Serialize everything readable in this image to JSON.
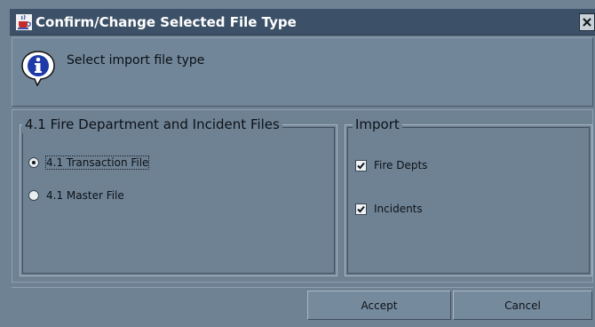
{
  "window": {
    "title": "Confirm/Change Selected File Type",
    "close_symbol": "×",
    "app_icon": "java-cup-icon"
  },
  "info": {
    "icon": "info-icon",
    "message": "Select import file type"
  },
  "fire_group": {
    "legend": "4.1 Fire Department and Incident Files",
    "options": [
      {
        "label": "4.1 Transaction File",
        "selected": true
      },
      {
        "label": "4.1 Master File",
        "selected": false
      }
    ]
  },
  "import_group": {
    "legend": "Import",
    "options": [
      {
        "label": "Fire Depts",
        "checked": true
      },
      {
        "label": "Incidents",
        "checked": true
      }
    ]
  },
  "buttons": {
    "accept": "Accept",
    "cancel": "Cancel"
  },
  "colors": {
    "titlebar": "#3c5168",
    "background": "#6f8294",
    "button": "#768a9e"
  }
}
